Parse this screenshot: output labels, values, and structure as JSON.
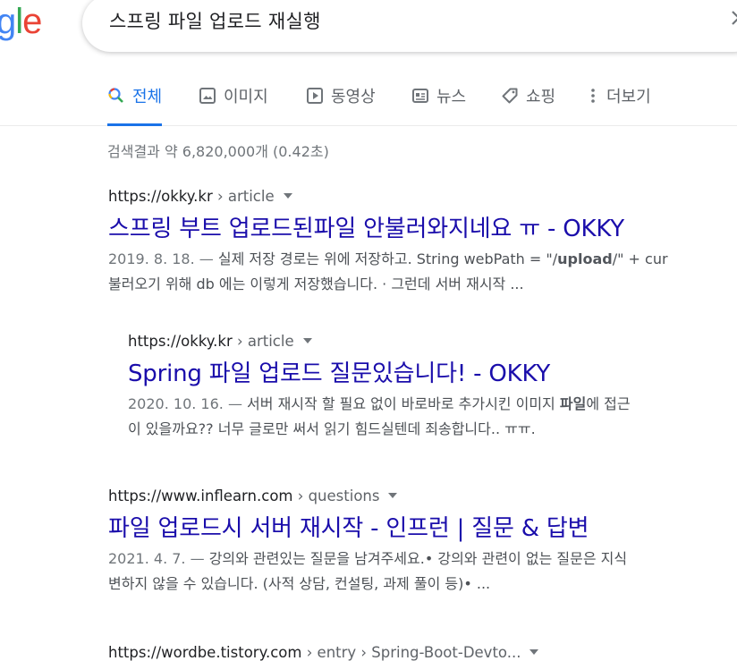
{
  "logo": {
    "part1": "g",
    "part2": "l",
    "part3": "e"
  },
  "search": {
    "query": "스프링 파일 업로드 재실행"
  },
  "tabs": [
    {
      "label": "전체",
      "icon": "search-icon"
    },
    {
      "label": "이미지",
      "icon": "image-icon"
    },
    {
      "label": "동영상",
      "icon": "video-icon"
    },
    {
      "label": "뉴스",
      "icon": "news-icon"
    },
    {
      "label": "쇼핑",
      "icon": "tag-icon"
    },
    {
      "label": "더보기",
      "icon": "more-vert-icon"
    }
  ],
  "stats": "검색결과 약 6,820,000개 (0.42초)",
  "results": [
    {
      "url_host": "https://okky.kr",
      "url_path": " › article",
      "title": "스프링 부트 업로드된파일 안불러와지네요 ㅠ - OKKY",
      "date": "2019. 8. 18. — ",
      "line1_a": "실제 저장 경로는 위에 저장하고. String webPath = \"/",
      "line1_b": "upload",
      "line1_c": "/\" + cur",
      "line2": "불러오기 위해 db 에는 이렇게 저장했습니다. · 그런데 서버 재시작 ..."
    },
    {
      "url_host": "https://okky.kr",
      "url_path": " › article",
      "title": "Spring 파일 업로드 질문있습니다! - OKKY",
      "date": "2020. 10. 16. — ",
      "line1_a": "서버 재시작 할 필요 없이 바로바로 추가시킨 이미지 ",
      "line1_b": "파일",
      "line1_c": "에 접근",
      "line2": "이 있을까요?? 너무 글로만 써서 읽기 힘드실텐데 죄송합니다.. ㅠㅠ."
    },
    {
      "url_host": "https://www.inflearn.com",
      "url_path": " › questions",
      "title": "파일 업로드시 서버 재시작 - 인프런 | 질문 & 답변",
      "date": "2021. 4. 7. — ",
      "line1_a": "강의와 관련있는 질문을 남겨주세요.• 강의와 관련이 없는 질문은 지식",
      "line2": "변하지 않을 수 있습니다. (사적 상담, 컨설팅, 과제 풀이 등)• ..."
    },
    {
      "url_host": "https://wordbe.tistory.com",
      "url_path": " › entry › Spring-Boot-Devto..."
    }
  ],
  "colors": {
    "link": "#1a0dab",
    "accent": "#1a73e8"
  }
}
